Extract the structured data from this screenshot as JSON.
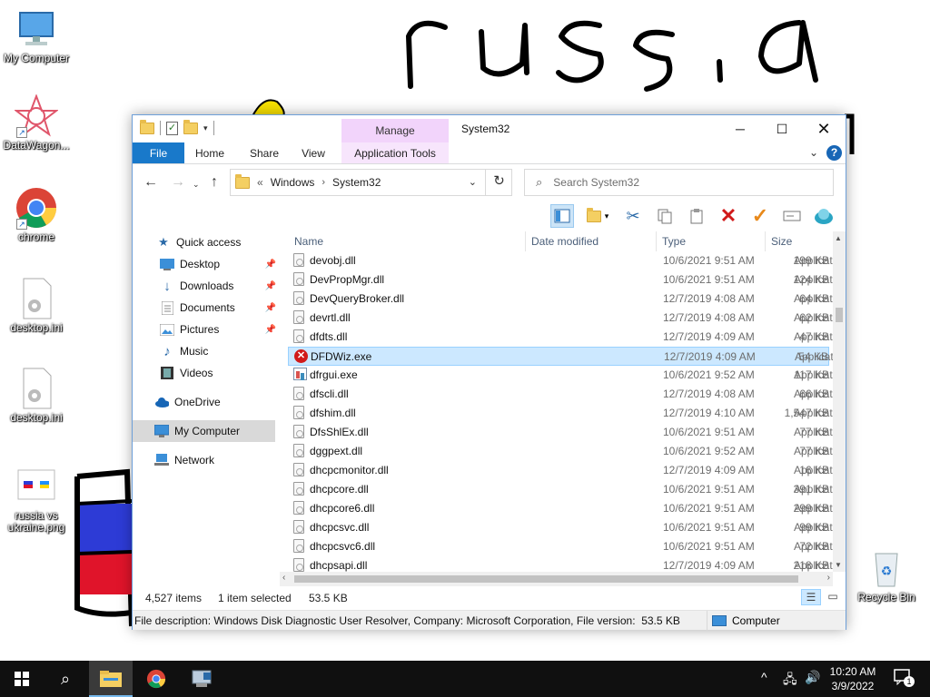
{
  "desktop": {
    "scribble_text": "russia",
    "icons": [
      {
        "label": "My Computer",
        "icon": "monitor-icon"
      },
      {
        "label": "DataWagon...",
        "icon": "datawagon-icon"
      },
      {
        "label": "chrome",
        "icon": "chrome-icon"
      },
      {
        "label": "desktop.ini",
        "icon": "ini-file-icon"
      },
      {
        "label": "desktop.ini",
        "icon": "ini-file-icon"
      },
      {
        "label": "russia vs ukraine.png",
        "icon": "image-file-icon"
      },
      {
        "label": "Recycle Bin",
        "icon": "recycle-bin-icon"
      }
    ]
  },
  "window": {
    "title": "System32",
    "contextual_group": "Manage",
    "tabs": [
      "File",
      "Home",
      "Share",
      "View",
      "Application Tools"
    ],
    "address": {
      "prefix": "«",
      "crumbs": [
        "Windows",
        "System32"
      ]
    },
    "search_placeholder": "Search System32",
    "nav_pane": [
      {
        "label": "Quick access",
        "icon": "star-icon",
        "pinned": false
      },
      {
        "label": "Desktop",
        "icon": "desktop-icon",
        "pinned": true
      },
      {
        "label": "Downloads",
        "icon": "download-icon",
        "pinned": true
      },
      {
        "label": "Documents",
        "icon": "documents-icon",
        "pinned": true
      },
      {
        "label": "Pictures",
        "icon": "pictures-icon",
        "pinned": true
      },
      {
        "label": "Music",
        "icon": "music-icon",
        "pinned": false
      },
      {
        "label": "Videos",
        "icon": "videos-icon",
        "pinned": false
      },
      {
        "label": "OneDrive",
        "icon": "cloud-icon",
        "pinned": false
      },
      {
        "label": "My Computer",
        "icon": "monitor-icon",
        "pinned": false
      },
      {
        "label": "Network",
        "icon": "network-icon",
        "pinned": false
      }
    ],
    "columns": [
      "Name",
      "Date modified",
      "Type",
      "Size"
    ],
    "files": [
      {
        "name": "devobj.dll",
        "date": "10/6/2021 9:51 AM",
        "type": "Application exten...",
        "size": "199 KB",
        "icon": "dll"
      },
      {
        "name": "DevPropMgr.dll",
        "date": "10/6/2021 9:51 AM",
        "type": "Application exten...",
        "size": "124 KB",
        "icon": "dll"
      },
      {
        "name": "DevQueryBroker.dll",
        "date": "12/7/2019 4:08 AM",
        "type": "Application exten...",
        "size": "64 KB",
        "icon": "dll"
      },
      {
        "name": "devrtl.dll",
        "date": "12/7/2019 4:08 AM",
        "type": "Application exten...",
        "size": "62 KB",
        "icon": "dll"
      },
      {
        "name": "dfdts.dll",
        "date": "12/7/2019 4:09 AM",
        "type": "Application exten...",
        "size": "47 KB",
        "icon": "dll"
      },
      {
        "name": "DFDWiz.exe",
        "date": "12/7/2019 4:09 AM",
        "type": "Application",
        "size": "54 KB",
        "icon": "err",
        "selected": true
      },
      {
        "name": "dfrgui.exe",
        "date": "10/6/2021 9:52 AM",
        "type": "Application",
        "size": "117 KB",
        "icon": "app"
      },
      {
        "name": "dfscli.dll",
        "date": "12/7/2019 4:08 AM",
        "type": "Application exten...",
        "size": "66 KB",
        "icon": "dll"
      },
      {
        "name": "dfshim.dll",
        "date": "12/7/2019 4:10 AM",
        "type": "Application exten...",
        "size": "1,547 KB",
        "icon": "dll"
      },
      {
        "name": "DfsShlEx.dll",
        "date": "10/6/2021 9:51 AM",
        "type": "Application exten...",
        "size": "77 KB",
        "icon": "dll"
      },
      {
        "name": "dggpext.dll",
        "date": "10/6/2021 9:52 AM",
        "type": "Application exten...",
        "size": "77 KB",
        "icon": "dll"
      },
      {
        "name": "dhcpcmonitor.dll",
        "date": "12/7/2019 4:09 AM",
        "type": "Application exten...",
        "size": "16 KB",
        "icon": "dll"
      },
      {
        "name": "dhcpcore.dll",
        "date": "10/6/2021 9:51 AM",
        "type": "Application exten...",
        "size": "391 KB",
        "icon": "dll"
      },
      {
        "name": "dhcpcore6.dll",
        "date": "10/6/2021 9:51 AM",
        "type": "Application exten...",
        "size": "299 KB",
        "icon": "dll"
      },
      {
        "name": "dhcpcsvc.dll",
        "date": "10/6/2021 9:51 AM",
        "type": "Application exten...",
        "size": "99 KB",
        "icon": "dll"
      },
      {
        "name": "dhcpcsvc6.dll",
        "date": "10/6/2021 9:51 AM",
        "type": "Application exten...",
        "size": "72 KB",
        "icon": "dll"
      },
      {
        "name": "dhcpsapi.dll",
        "date": "12/7/2019 4:09 AM",
        "type": "Application exten...",
        "size": "218 KB",
        "icon": "dll"
      }
    ],
    "status": {
      "item_count": "4,527 items",
      "selection": "1 item selected",
      "selection_size": "53.5 KB"
    },
    "details": {
      "description": "File description: Windows Disk Diagnostic User Resolver, Company: Microsoft Corporation, File version:",
      "size": "53.5 KB",
      "zone": "Computer"
    }
  },
  "taskbar": {
    "time": "10:20 AM",
    "date": "3/9/2022",
    "notification_count": "1",
    "items": [
      "start-icon",
      "search-icon",
      "file-explorer-icon",
      "chrome-icon",
      "remote-desktop-icon"
    ]
  },
  "colors": {
    "accent": "#1979ca",
    "selection": "#cce8ff",
    "manage_tab": "#f2d4fb",
    "taskbar": "#101010"
  }
}
